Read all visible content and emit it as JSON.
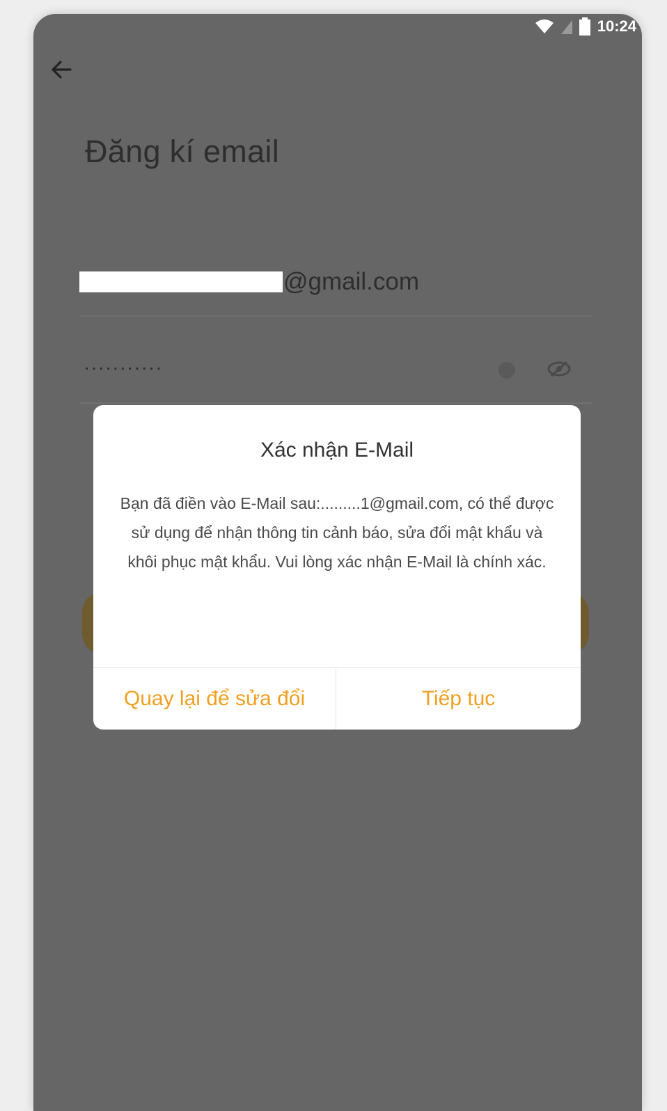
{
  "status_bar": {
    "time": "10:24",
    "icons": [
      "wifi-icon",
      "signal-icon",
      "battery-icon"
    ]
  },
  "header": {
    "back_icon": "arrow-left-icon"
  },
  "page": {
    "title": "Đăng kí email"
  },
  "form": {
    "email_visible_suffix": "@gmail.com",
    "password_masked": "···········",
    "clear_icon": "clear-icon",
    "visibility_icon": "eye-icon"
  },
  "dialog": {
    "title": "Xác nhận E-Mail",
    "message": "Bạn đã điền vào E-Mail sau:.........1@gmail.com, có thể được sử dụng để nhận thông tin cảnh báo, sửa đổi mật khẩu và khôi phục mật khẩu. Vui lòng xác nhận E-Mail là chính xác.",
    "cancel_label": "Quay lại để sửa đổi",
    "confirm_label": "Tiếp tục"
  },
  "colors": {
    "overlay_background": "#666666",
    "dialog_background": "#ffffff",
    "accent": "#f0a020",
    "text_primary": "#333333"
  }
}
